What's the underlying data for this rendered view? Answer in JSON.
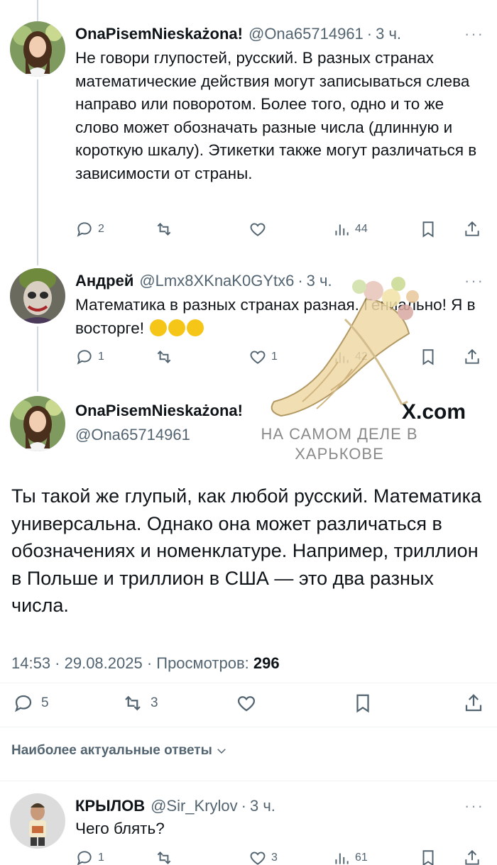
{
  "thread": [
    {
      "author_name": "OnaPisemNieskażona!",
      "handle": "@Ona65714961",
      "time": "3 ч.",
      "text": "Не говори глупостей, русский. В разных странах математические действия могут записываться слева направо или поворотом. Более того, одно и то же слово может обозначать разные числа (длинную и короткую шкалу). Этикетки также могут различаться в зависимости от страны.",
      "replies": "2",
      "reposts": "",
      "likes": "",
      "views": "44"
    },
    {
      "author_name": "Андрей",
      "handle": "@Lmx8XKnaK0GYtx6",
      "time": "3 ч.",
      "text": "Математика в разных странах разная. Гениально! Я в восторге!",
      "emoji": [
        "rofl-emoji",
        "rofl-emoji",
        "rofl-emoji"
      ],
      "replies": "1",
      "reposts": "",
      "likes": "1",
      "views": "42"
    }
  ],
  "main_tweet": {
    "author_name": "OnaPisemNieskażona!",
    "handle": "@Ona65714961",
    "text": "Ты такой же глупый, как любой русский. Математика универсальна. Однако она может различаться в обозначениях и номенклатуре. Например, триллион в Польше и триллион в США — это два разных числа.",
    "timestamp": "14:53 · 29.08.2025 · Просмотров:",
    "views": "296",
    "replies": "5",
    "reposts": "3"
  },
  "watermark": {
    "brand": "X.com",
    "caption": "НА САМОМ ДЕЛЕ В ХАРЬКОВЕ"
  },
  "replies_section": {
    "sort_label": "Наиболее актуальные ответы"
  },
  "reply": {
    "author_name": "КРЫЛОВ",
    "handle": "@Sir_Krylov",
    "time": "3 ч.",
    "text": "Чего блять?",
    "replies": "1",
    "likes": "3",
    "views": "61"
  },
  "ui": {
    "dot": "·",
    "more": "···",
    "colors": {
      "text": "#0f1419",
      "muted": "#536471",
      "line": "#cfd9de",
      "emoji": "#f5c518"
    },
    "icons": [
      "reply-icon",
      "repost-icon",
      "like-icon",
      "views-icon",
      "bookmark-icon",
      "share-icon",
      "more-icon",
      "chevron-down-icon"
    ]
  }
}
